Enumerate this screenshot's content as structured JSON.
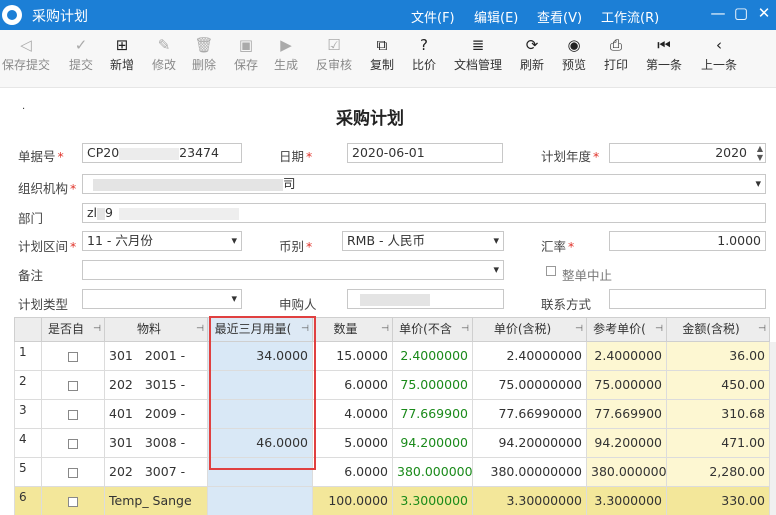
{
  "app": {
    "title": "采购计划",
    "menu": [
      "文件(F)",
      "编辑(E)",
      "查看(V)",
      "工作流(R)"
    ],
    "window_controls": [
      "—",
      "▢",
      "✕"
    ]
  },
  "toolbar": [
    {
      "label": "保存提交",
      "icon": "send-icon",
      "glyph": "◁",
      "disabled": true
    },
    {
      "label": "提交",
      "icon": "check-circle-icon",
      "glyph": "✓",
      "disabled": true
    },
    {
      "label": "新增",
      "icon": "add-doc-icon",
      "glyph": "⊞",
      "disabled": false
    },
    {
      "label": "修改",
      "icon": "edit-icon",
      "glyph": "✎",
      "disabled": true
    },
    {
      "label": "删除",
      "icon": "trash-icon",
      "glyph": "🗑",
      "disabled": true
    },
    {
      "label": "保存",
      "icon": "save-icon",
      "glyph": "▣",
      "disabled": true
    },
    {
      "label": "生成",
      "icon": "play-icon",
      "glyph": "▶",
      "disabled": true
    },
    {
      "label": "反审核",
      "icon": "unaudit-icon",
      "glyph": "☑",
      "disabled": true
    },
    {
      "label": "复制",
      "icon": "copy-icon",
      "glyph": "⧉",
      "disabled": false
    },
    {
      "label": "比价",
      "icon": "compare-icon",
      "glyph": "?",
      "disabled": false
    },
    {
      "label": "文档管理",
      "icon": "document-icon",
      "glyph": "≣",
      "disabled": false
    },
    {
      "label": "刷新",
      "icon": "refresh-icon",
      "glyph": "⟳",
      "disabled": false
    },
    {
      "label": "预览",
      "icon": "eye-icon",
      "glyph": "◉",
      "disabled": false
    },
    {
      "label": "打印",
      "icon": "print-icon",
      "glyph": "⎙",
      "disabled": false
    },
    {
      "label": "第一条",
      "icon": "first-record-icon",
      "glyph": "⏮",
      "disabled": false
    },
    {
      "label": "上一条",
      "icon": "previous-record-icon",
      "glyph": "‹",
      "disabled": false
    }
  ],
  "form": {
    "title": "采购计划",
    "marker": "·",
    "doc_no": {
      "label": "单据号",
      "prefix": "CP20",
      "suffix": "23474"
    },
    "date": {
      "label": "日期",
      "value": "2020-06-01"
    },
    "plan_year": {
      "label": "计划年度",
      "value": "2020"
    },
    "org": {
      "label": "组织机构",
      "suffix": "司"
    },
    "dept": {
      "label": "部门",
      "prefix": "zl",
      "mid": "9"
    },
    "plan_period": {
      "label": "计划区间",
      "value": "11 - 六月份"
    },
    "currency": {
      "label": "币别",
      "value": "RMB - 人民币"
    },
    "rate": {
      "label": "汇率",
      "value": "1.0000"
    },
    "remark": {
      "label": "备注",
      "value": ""
    },
    "terminate": {
      "label": "整单中止"
    },
    "plan_type": {
      "label": "计划类型",
      "value": ""
    },
    "applicant": {
      "label": "申购人",
      "value": ""
    },
    "contact": {
      "label": "联系方式",
      "value": ""
    }
  },
  "grid": {
    "headers": [
      "是否自",
      "物料",
      "最近三月用量(",
      "数量",
      "单价(不含",
      "单价(含税)",
      "参考单价(",
      "金额(含税)"
    ],
    "rows": [
      {
        "no": "1",
        "material": "301",
        "material2": "2001 -",
        "recent": "34.0000",
        "qty": "15.0000",
        "price_ex": "2.4000000",
        "price_inc": "2.40000000",
        "ref": "2.4000000",
        "amount": "36.00"
      },
      {
        "no": "2",
        "material": "202",
        "material2": "3015 -",
        "recent": "",
        "qty": "6.0000",
        "price_ex": "75.000000",
        "price_inc": "75.00000000",
        "ref": "75.000000",
        "amount": "450.00"
      },
      {
        "no": "3",
        "material": "401",
        "material2": "2009 -",
        "recent": "",
        "qty": "4.0000",
        "price_ex": "77.669900",
        "price_inc": "77.66990000",
        "ref": "77.669900",
        "amount": "310.68"
      },
      {
        "no": "4",
        "material": "301",
        "material2": "3008 -",
        "recent": "46.0000",
        "qty": "5.0000",
        "price_ex": "94.200000",
        "price_inc": "94.20000000",
        "ref": "94.200000",
        "amount": "471.00"
      },
      {
        "no": "5",
        "material": "202",
        "material2": "3007 -",
        "recent": "",
        "qty": "6.0000",
        "price_ex": "380.000000",
        "price_inc": "380.00000000",
        "ref": "380.000000",
        "amount": "2,280.00"
      },
      {
        "no": "6",
        "material": "Temp_ Sange",
        "material2": "",
        "recent": "",
        "qty": "100.0000",
        "price_ex": "3.3000000",
        "price_inc": "3.30000000",
        "ref": "3.3000000",
        "amount": "330.00"
      }
    ]
  },
  "colors": {
    "titlebar": "#1c7fd6",
    "highlight_border": "#e04040",
    "yellow_cell": "#fdf7d2",
    "blue_cell": "#d9e8f6",
    "selected_row": "#f3e79a",
    "price_green": "#1a8a1a"
  }
}
